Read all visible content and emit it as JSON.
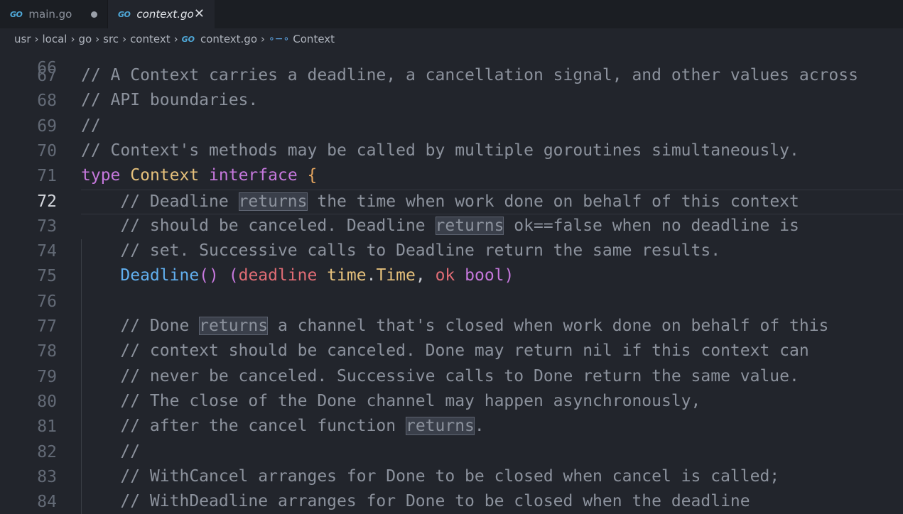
{
  "tabs": [
    {
      "icon": "GO",
      "label": "main.go",
      "state": "modified"
    },
    {
      "icon": "GO",
      "label": "context.go",
      "state": "active"
    }
  ],
  "breadcrumb": {
    "parts": [
      "usr",
      "local",
      "go",
      "src",
      "context"
    ],
    "file": "context.go",
    "symbol": "Context",
    "file_icon": "GO",
    "symbol_icon": "∘−∘"
  },
  "editor": {
    "partial_line": "66",
    "lines": [
      {
        "n": "67",
        "tokens": [
          {
            "t": "c",
            "v": "// A Context carries a deadline, a cancellation signal, and other values across"
          }
        ]
      },
      {
        "n": "68",
        "tokens": [
          {
            "t": "c",
            "v": "// API boundaries."
          }
        ]
      },
      {
        "n": "69",
        "tokens": [
          {
            "t": "c",
            "v": "//"
          }
        ]
      },
      {
        "n": "70",
        "tokens": [
          {
            "t": "c",
            "v": "// Context's methods may be called by multiple goroutines simultaneously."
          }
        ]
      },
      {
        "n": "71",
        "tokens": [
          {
            "t": "kw",
            "v": "type"
          },
          {
            "t": "tx",
            "v": " "
          },
          {
            "t": "ty",
            "v": "Context"
          },
          {
            "t": "tx",
            "v": " "
          },
          {
            "t": "kw",
            "v": "interface"
          },
          {
            "t": "tx",
            "v": " "
          },
          {
            "t": "br",
            "v": "{"
          }
        ]
      },
      {
        "n": "72",
        "current": true,
        "tokens": [
          {
            "t": "c",
            "v": "    // Deadline "
          },
          {
            "t": "c hl",
            "v": "returns"
          },
          {
            "t": "c",
            "v": " the time when work done on behalf of this context"
          }
        ]
      },
      {
        "n": "73",
        "tokens": [
          {
            "t": "c",
            "v": "    // should be canceled. Deadline "
          },
          {
            "t": "c hl",
            "v": "returns"
          },
          {
            "t": "c",
            "v": " ok==false when no deadline is"
          }
        ]
      },
      {
        "n": "74",
        "tokens": [
          {
            "t": "c",
            "v": "    // set. Successive calls to Deadline return the same results."
          }
        ]
      },
      {
        "n": "75",
        "tokens": [
          {
            "t": "tx",
            "v": "    "
          },
          {
            "t": "fn",
            "v": "Deadline"
          },
          {
            "t": "br2",
            "v": "()"
          },
          {
            "t": "tx",
            "v": " "
          },
          {
            "t": "br2",
            "v": "("
          },
          {
            "t": "pn",
            "v": "deadline"
          },
          {
            "t": "tx",
            "v": " "
          },
          {
            "t": "ty",
            "v": "time"
          },
          {
            "t": "tx",
            "v": "."
          },
          {
            "t": "ty",
            "v": "Time"
          },
          {
            "t": "tx",
            "v": ", "
          },
          {
            "t": "pn",
            "v": "ok"
          },
          {
            "t": "tx",
            "v": " "
          },
          {
            "t": "kw",
            "v": "bool"
          },
          {
            "t": "br2",
            "v": ")"
          }
        ]
      },
      {
        "n": "76",
        "tokens": []
      },
      {
        "n": "77",
        "tokens": [
          {
            "t": "c",
            "v": "    // Done "
          },
          {
            "t": "c hl",
            "v": "returns"
          },
          {
            "t": "c",
            "v": " a channel that's closed when work done on behalf of this"
          }
        ]
      },
      {
        "n": "78",
        "tokens": [
          {
            "t": "c",
            "v": "    // context should be canceled. Done may return nil if this context can"
          }
        ]
      },
      {
        "n": "79",
        "tokens": [
          {
            "t": "c",
            "v": "    // never be canceled. Successive calls to Done return the same value."
          }
        ]
      },
      {
        "n": "80",
        "tokens": [
          {
            "t": "c",
            "v": "    // The close of the Done channel may happen asynchronously,"
          }
        ]
      },
      {
        "n": "81",
        "tokens": [
          {
            "t": "c",
            "v": "    // after the cancel function "
          },
          {
            "t": "c hl",
            "v": "returns"
          },
          {
            "t": "c",
            "v": "."
          }
        ]
      },
      {
        "n": "82",
        "tokens": [
          {
            "t": "c",
            "v": "    //"
          }
        ]
      },
      {
        "n": "83",
        "tokens": [
          {
            "t": "c",
            "v": "    // WithCancel arranges for Done to be closed when cancel is called;"
          }
        ]
      },
      {
        "n": "84",
        "tokens": [
          {
            "t": "c",
            "v": "    // WithDeadline arranges for Done to be closed when the deadline"
          }
        ]
      }
    ]
  }
}
